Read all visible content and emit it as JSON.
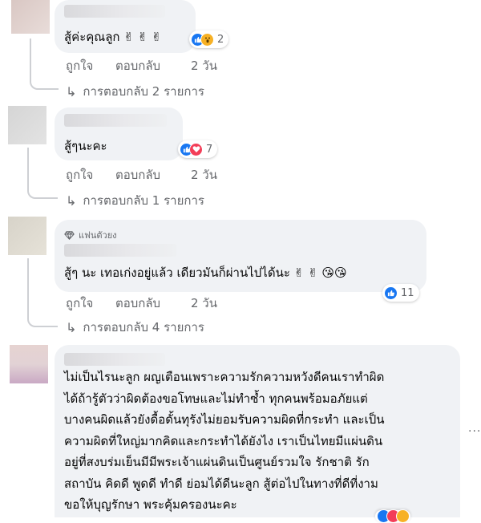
{
  "comments": [
    {
      "text": "สู้ค่ะคุณลูก ✌ ✌ ✌",
      "reactions": {
        "icons": [
          "like-icon",
          "wow-icon"
        ],
        "count": "2"
      },
      "actions": {
        "like": "ถูกใจ",
        "reply": "ตอบกลับ",
        "time": "2 วัน"
      },
      "replies": "การตอบกลับ 2 รายการ"
    },
    {
      "text": "สู้ๆนะคะ",
      "reactions": {
        "icons": [
          "like-icon",
          "love-icon"
        ],
        "count": "7"
      },
      "actions": {
        "like": "ถูกใจ",
        "reply": "ตอบกลับ",
        "time": "2 วัน"
      },
      "replies": "การตอบกลับ 1 รายการ"
    },
    {
      "badge": "แฟนตัวยง",
      "text": "สู้ๆ นะ เทอเก่งอยู่แล้ว เดียวมันก็ผ่านไปได้นะ ✌ ✌ 😘😘",
      "reactions": {
        "icons": [
          "like-icon"
        ],
        "count": "11"
      },
      "actions": {
        "like": "ถูกใจ",
        "reply": "ตอบกลับ",
        "time": "2 วัน"
      },
      "replies": "การตอบกลับ 4 รายการ"
    },
    {
      "lines": [
        "ไม่เป็นไรนะลูก ผญเตือนเพราะความรักความหวังดีคนเราทำผิด",
        "ได้ถ้ารู้ตัวว่าผิดต้องขอโทษและไม่ทำซ้ำ ทุกคนพร้อมอภัยแต่",
        "บางคนผิดแล้วยังดื้อดั้นทุรังไม่ยอมรับความผิดที่กระทำ และเป็น",
        "ความผิดที่ใหญ่มากคิดและกระทำได้ยังไง เราเป็นไทยมีแผ่นดิน",
        "อยู่ที่สงบร่มเย็นมีมีพระเจ้าแผ่นดินเป็นศูนย์รวมใจ รักชาติ รัก",
        "สถาบัน คิดดี พูดดี ทำดี ย่อมได้ดีนะลูก สู้ต่อไปในทางที่ดีที่งาม",
        "ขอให้บุญรักษา พระคุ้มครองนะคะ"
      ],
      "more": "..."
    }
  ],
  "colors": {
    "bubble": "#f0f2f5",
    "meta": "#65676b",
    "like": "#1877f2",
    "love": "#f33e58",
    "wow": "#f7b125"
  }
}
